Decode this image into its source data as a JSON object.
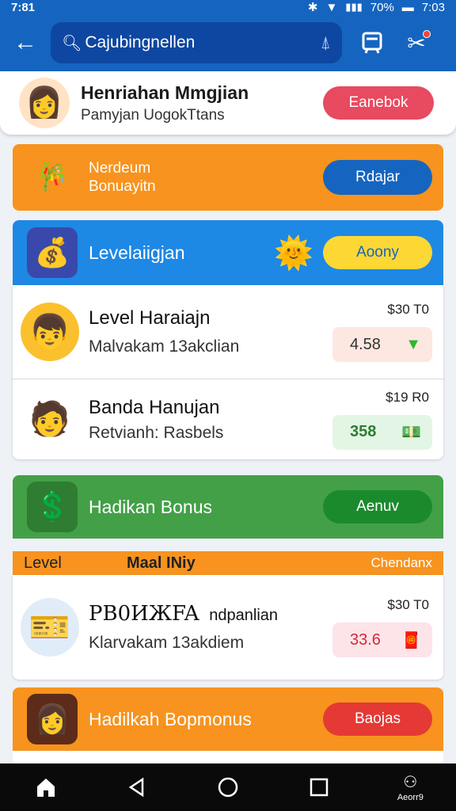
{
  "status_bar": {
    "time_left": "7:81",
    "battery": "70%",
    "time_right": "7:03"
  },
  "app_bar": {
    "search_text": "Cajubingnellen",
    "search_icon": "search-icon",
    "mic_icon": "mic-icon",
    "action_1_icon": "bookmark-icon",
    "action_2_icon": "tools-icon"
  },
  "profile": {
    "name": "Henriahan Mmgjian",
    "subtitle": "Pamyjan UogokTtans",
    "button": "Eanebok"
  },
  "banner_1": {
    "title_line1": "Nerdeum",
    "title_line2": "Bonuayitn",
    "button": "Rdajar"
  },
  "banner_2": {
    "title": "Levelaiigjan",
    "button": "Aoony"
  },
  "list_1": [
    {
      "title": "Level Haraiajn",
      "subtitle": "Malvakam 13akclian",
      "price": "$30 T0",
      "chip": "4.58"
    },
    {
      "title": "Banda Hanujan",
      "subtitle": "Retvianh: Rasbels",
      "price": "$19 R0",
      "chip": "358"
    }
  ],
  "banner_3": {
    "title": "Hadikan Bonus",
    "button": "Aenuv"
  },
  "level_strip": {
    "col1": "Level",
    "col2": "Maal INiy",
    "col3": "Chendanx"
  },
  "list_2": [
    {
      "title_big": "PB0ИЖFA",
      "title_small": "ndpanlian",
      "subtitle": "Klarvakam 13akdiem",
      "price": "$30 T0",
      "chip": "33.6"
    }
  ],
  "banner_4": {
    "title": "Hadilkah Bopmonus",
    "button": "Baojas"
  },
  "nav": {
    "home_label": "",
    "profile_label": "Aeorr9"
  },
  "colors": {
    "primary": "#1565c0",
    "orange": "#f7931e",
    "blue": "#1e88e5",
    "green": "#43a047",
    "red": "#e53935"
  }
}
